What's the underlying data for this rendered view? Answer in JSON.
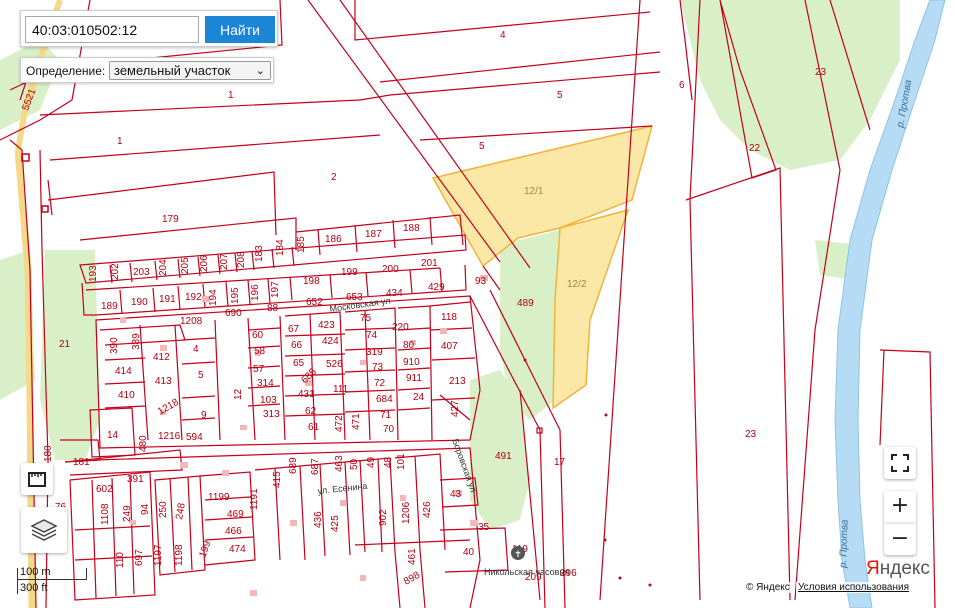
{
  "search": {
    "value": "40:03:010502:12",
    "button_label": "Найти"
  },
  "definition": {
    "label": "Определение:",
    "selected": "земельный участок"
  },
  "plots": {
    "p1a": "1",
    "p1b": "1",
    "p2": "2",
    "p4": "4",
    "p5a": "5",
    "p5b": "5",
    "p6": "6",
    "p22": "22",
    "p23a": "23",
    "p23b": "23",
    "p12_1": "12/1",
    "p12_2": "12/2",
    "p179": "179",
    "p186": "186",
    "p187": "187",
    "p188": "188",
    "p184": "184",
    "p185": "185",
    "p183": "183",
    "p208": "208",
    "p207": "207",
    "p206": "206",
    "p205": "205",
    "p204": "204",
    "p203": "203",
    "p202": "202",
    "p193": "193",
    "p201": "201",
    "p200": "200",
    "p199": "199",
    "p198": "198",
    "p197": "197",
    "p196": "196",
    "p195": "195",
    "p194": "194",
    "p192": "192",
    "p191": "191",
    "p190": "190",
    "p189": "189",
    "p93": "93",
    "p489": "489",
    "p434": "434",
    "p429": "429",
    "p653": "653",
    "p652": "652",
    "p88": "88",
    "p690": "690",
    "p1208": "1208",
    "p75": "75",
    "p118": "118",
    "p220": "220",
    "p74": "74",
    "p423": "423",
    "p67": "67",
    "p60": "60",
    "p424": "424",
    "p66": "66",
    "p407": "407",
    "p80": "80",
    "p319": "319",
    "p58": "58",
    "p65": "65",
    "p910": "910",
    "p73": "73",
    "p57": "57",
    "p526": "526",
    "p911": "911",
    "p72": "72",
    "p213": "213",
    "p314": "314",
    "p111": "111",
    "p685": "685",
    "p103": "103",
    "p431": "431",
    "p684": "684",
    "p24": "24",
    "p427": "427",
    "p62": "62",
    "p313": "313",
    "p472": "472",
    "p471": "471",
    "p71": "71",
    "p70": "70",
    "p61": "61",
    "p21": "21",
    "p390": "390",
    "p389": "389",
    "p412": "412",
    "p4b": "4",
    "p5c": "5",
    "p414": "414",
    "p413": "413",
    "p410": "410",
    "p1218": "1218",
    "p9": "9",
    "p14": "14",
    "p480": "480",
    "p1216": "1216",
    "p594": "594",
    "p180": "180",
    "p181": "181",
    "p491": "491",
    "p17": "17",
    "p602": "602",
    "p391": "391",
    "p76": "76",
    "p1108": "1108",
    "p249": "249",
    "p94": "94",
    "p250": "250",
    "p248": "248",
    "p1199": "1199",
    "p469": "469",
    "p466": "466",
    "p474": "474",
    "p110": "110",
    "p697": "697",
    "p1197": "1197",
    "p1198": "1198",
    "p199b": "199",
    "p689": "689",
    "p687": "687",
    "p463": "463",
    "p50": "50",
    "p49": "49",
    "p48": "48",
    "p101": "101",
    "p43": "43",
    "p415": "415",
    "p436": "436",
    "p425": "425",
    "p902": "902",
    "p1206": "1206",
    "p426": "426",
    "p35": "35",
    "p40": "40",
    "p119": "119",
    "p209": "209",
    "p296": "296",
    "p461": "461",
    "p898": "898",
    "p5521": "5521",
    "p1191": "1191",
    "p12": "12"
  },
  "streets": {
    "moskovskaya": "Московская ул",
    "esenina": "ул. Есенина",
    "borovskaya": "Боровская ул",
    "nikolskaya": "Никольская часовня",
    "provva_top": "р. Протва",
    "provva_bottom": "р. Протва"
  },
  "controls": {
    "fullscreen_icon": "fullscreen-icon",
    "zoom_in_label": "+",
    "zoom_out_label": "−",
    "ruler_icon": "ruler-icon",
    "layers_icon": "layers-icon"
  },
  "scale": {
    "metric": "100 m",
    "imperial": "300 ft"
  },
  "footer": {
    "copyright": "© Яндекс",
    "terms": "Условия использования",
    "logo_ya": "Я",
    "logo_rest": "ндекс"
  },
  "colors": {
    "boundary": "#c4001a",
    "selected_fill": "#fbe8a6",
    "selected_border": "#f2b33d",
    "green": "#d9efc7",
    "river": "#b6dcf5",
    "search_button": "#1b85d6"
  }
}
